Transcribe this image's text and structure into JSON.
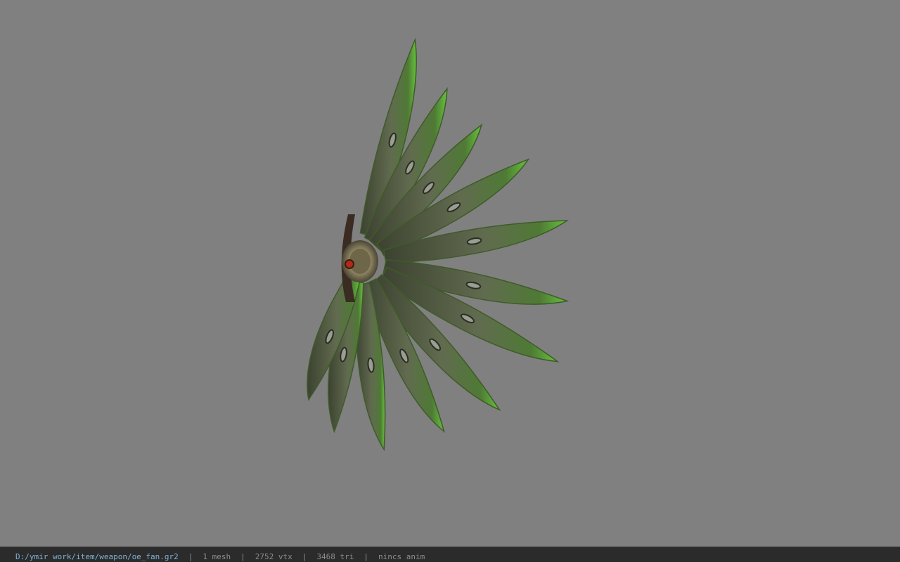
{
  "viewport": {
    "background_color": "#808080",
    "model": {
      "name": "oe_fan",
      "blade_color": "#6b7a5a",
      "edge_color": "#5fc43a",
      "hub_color": "#a89c74",
      "gem_color": "#b02a1a"
    }
  },
  "status_bar": {
    "file_path": "D:/ymir work/item/weapon/oe_fan.gr2",
    "separator": "|",
    "mesh_count": "1 mesh",
    "vertex_count": "2752 vtx",
    "triangle_count": "3468 tri",
    "anim_state": "nincs anim",
    "path_color": "#7fb2d6",
    "text_color": "#8c8c8c"
  }
}
